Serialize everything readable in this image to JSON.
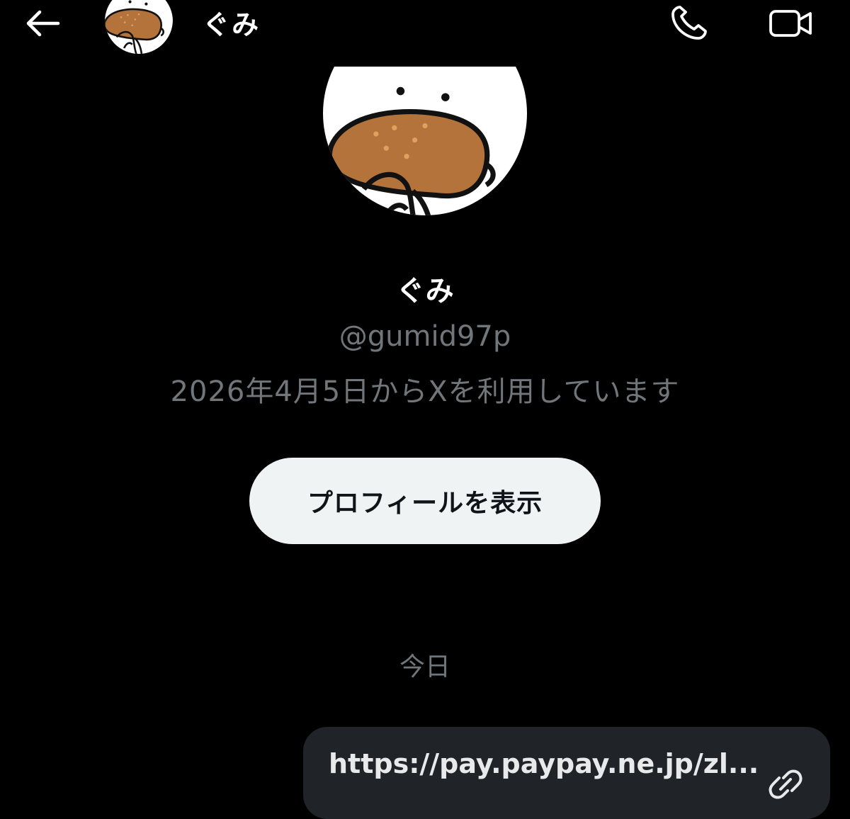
{
  "header": {
    "back_icon": "arrow-left-icon",
    "name": "ぐみ",
    "call_icon": "phone-icon",
    "video_icon": "video-camera-icon"
  },
  "profile": {
    "name": "ぐみ",
    "handle": "@gumid97p",
    "joined": "2026年4月5日からXを利用しています",
    "view_profile_label": "プロフィールを表示"
  },
  "conversation": {
    "date_separator": "今日",
    "messages": [
      {
        "text": "https://pay.paypay.ne.jp/zl...",
        "icon": "link-icon"
      }
    ]
  },
  "colors": {
    "background": "#000000",
    "secondary_text": "#71767b",
    "button_bg": "#eff3f4",
    "bubble_bg": "#202327"
  }
}
